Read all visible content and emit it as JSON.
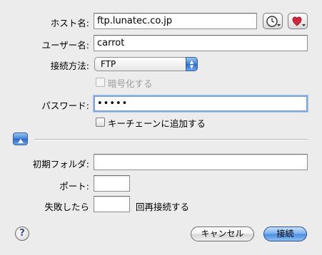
{
  "form": {
    "host": {
      "label": "ホスト名:",
      "value": "ftp.lunatec.co.jp"
    },
    "user": {
      "label": "ユーザー名:",
      "value": "carrot"
    },
    "connection": {
      "label": "接続方法:",
      "value": "FTP"
    },
    "encrypt": {
      "label": "暗号化する"
    },
    "password": {
      "label": "パスワード:",
      "value": "•••••"
    },
    "keychain": {
      "label": "キーチェーンに追加する"
    },
    "initial_folder": {
      "label": "初期フォルダ:",
      "value": ""
    },
    "port": {
      "label": "ポート:",
      "value": ""
    },
    "retry": {
      "label_before": "失敗したら",
      "value": "",
      "label_after": "回再接続する"
    }
  },
  "buttons": {
    "help": "?",
    "cancel": "キャンセル",
    "connect": "接続"
  },
  "icons": {
    "history": "clock-icon",
    "favorites": "heart-icon",
    "disclosure": "disclosure-triangle-up-icon",
    "popup_arrows": "up-down-arrows-icon"
  },
  "colors": {
    "accent": "#4d8ee0",
    "focus_ring": "#7ea6d8",
    "window_bg": "#ececec",
    "favorites_heart": "#d3263a"
  }
}
